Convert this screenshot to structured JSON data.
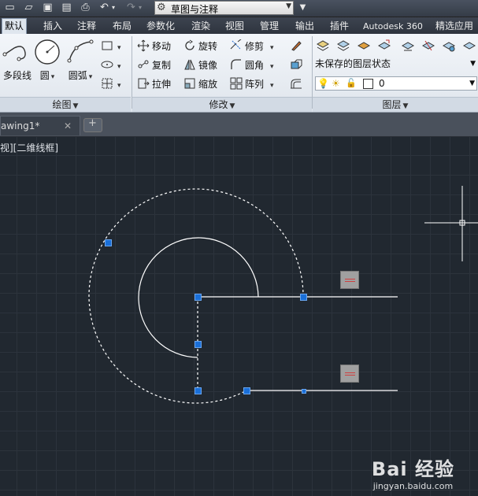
{
  "quick_access": {
    "icons": [
      "new-icon",
      "open-icon",
      "save-icon",
      "saveas-icon",
      "print-icon",
      "undo-icon",
      "redo-icon"
    ],
    "workspace": "草图与注释"
  },
  "menu_tabs": [
    {
      "label": "默认",
      "active": true
    },
    {
      "label": "插入"
    },
    {
      "label": "注释"
    },
    {
      "label": "布局"
    },
    {
      "label": "参数化"
    },
    {
      "label": "渲染"
    },
    {
      "label": "视图"
    },
    {
      "label": "管理"
    },
    {
      "label": "输出"
    },
    {
      "label": "插件"
    },
    {
      "label": "Autodesk 360"
    },
    {
      "label": "精选应用"
    }
  ],
  "draw_panel": {
    "title": "绘图",
    "polyline": "多段线",
    "circle": "圆",
    "arc": "圆弧"
  },
  "modify_panel": {
    "title": "修改",
    "move": "移动",
    "rotate": "旋转",
    "trim": "修剪",
    "copy": "复制",
    "mirror": "镜像",
    "fillet": "圆角",
    "stretch": "拉伸",
    "scale": "缩放",
    "array": "阵列"
  },
  "layers_panel": {
    "title": "图层",
    "state": "未保存的图层状态",
    "current_layer": "0"
  },
  "document_tab": {
    "name": "awing1*"
  },
  "viewport": {
    "label": "视][二维线框]"
  },
  "watermark": {
    "logo": "Bai 经验",
    "url": "jingyan.baidu.com"
  },
  "colors": {
    "grip": "#1a6fd8",
    "canvas": "#212830",
    "grid": "#2c333c"
  }
}
